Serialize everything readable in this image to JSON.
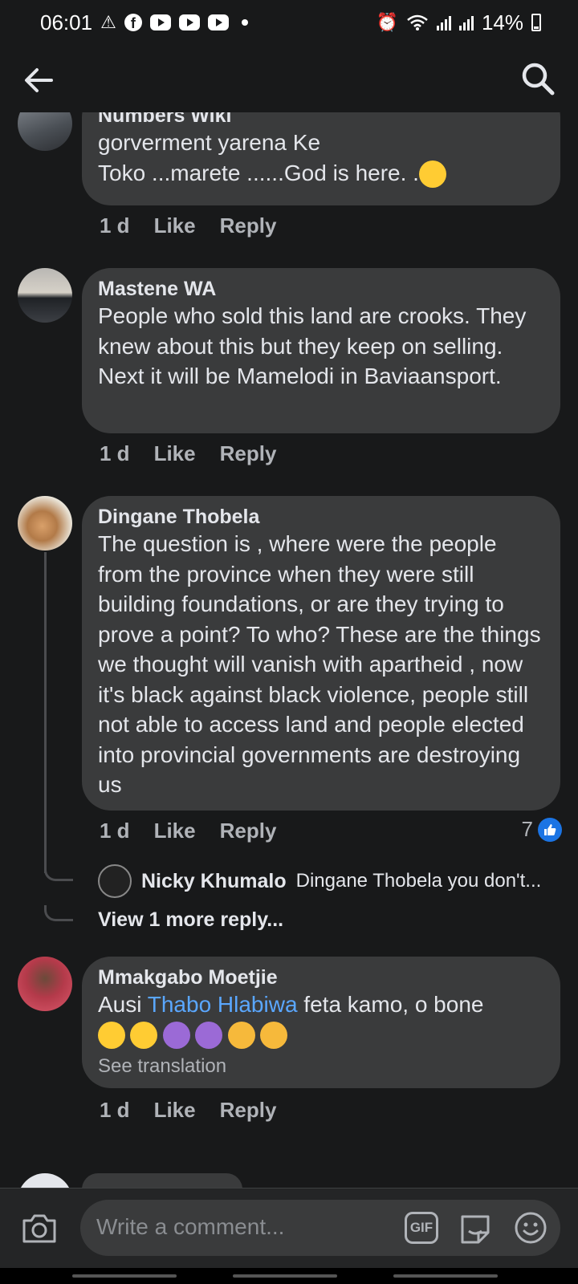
{
  "status_bar": {
    "time": "06:01",
    "battery": "14%",
    "icons": [
      "warning-icon",
      "facebook-icon",
      "youtube-icon",
      "youtube-icon",
      "youtube-icon",
      "alarm-icon",
      "wifi-icon",
      "signal-icon",
      "signal-icon",
      "battery-icon"
    ]
  },
  "header": {
    "back_icon": "arrow-left-icon",
    "search_icon": "search-icon"
  },
  "comments": [
    {
      "name": "Numbers Wiki",
      "text": "gorverment yarena Ke\nToko ...marete ......God is here.    .",
      "trailing_emoji": "crying-face-emoji",
      "time": "1 d",
      "like": "Like",
      "reply": "Reply"
    },
    {
      "name": "Mastene WA",
      "text": "People who sold this land are crooks. They knew about this but they keep on selling. Next it will be Mamelodi in Baviaansport.",
      "time": "1 d",
      "like": "Like",
      "reply": "Reply"
    },
    {
      "name": "Dingane Thobela",
      "text": "The question is , where were the people from the province when they were still building foundations, or are they trying to prove a point? To who? These are the things we thought will vanish with apartheid , now it's black against black violence, people still not able to access land and people elected into provincial governments are destroying us",
      "time": "1 d",
      "like": "Like",
      "reply": "Reply",
      "like_count": "7",
      "reply_preview": {
        "name": "Nicky Khumalo",
        "text": "Dingane Thobela you don't..."
      },
      "view_more": "View 1 more reply..."
    },
    {
      "name": "Mmakgabo Moetjie",
      "text_before": "Ausi ",
      "mention": "Thabo Hlabiwa",
      "text_after": " feta kamo, o bone",
      "emojis": [
        "flushed-face-emoji",
        "flushed-face-emoji",
        "person-gesturing-ok-emoji",
        "person-gesturing-ok-emoji",
        "sad-relieved-face-emoji",
        "sad-relieved-face-emoji"
      ],
      "see_translation": "See translation",
      "time": "1 d",
      "like": "Like",
      "reply": "Reply"
    }
  ],
  "composer": {
    "placeholder": "Write a comment...",
    "camera_icon": "camera-icon",
    "gif_label": "GIF",
    "sticker_icon": "sticker-icon",
    "emoji_icon": "smiley-icon"
  },
  "colors": {
    "background": "#18191a",
    "bubble": "#3a3b3c",
    "text": "#e4e6eb",
    "secondary_text": "#b0b3b8",
    "mention": "#5aa7ff",
    "like_blue": "#1b74e4"
  }
}
